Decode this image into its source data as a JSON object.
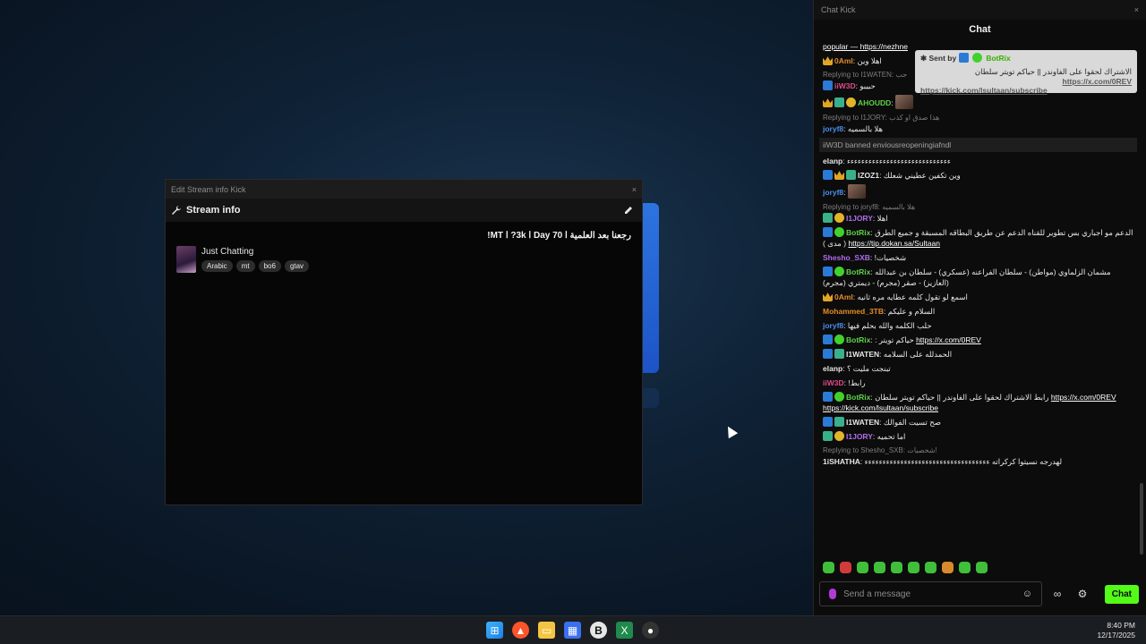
{
  "stream_window": {
    "titlebar": "Edit Stream info Kick",
    "close": "×",
    "header": "Stream info",
    "stream_title": "رجعنا بعد العلمية ا  Day 70  ا  3k?  ا  MT!",
    "category": "Just Chatting",
    "tags": [
      "Arabic",
      "mt",
      "bo6",
      "gtav"
    ]
  },
  "chat_window": {
    "titlebar": "Chat Kick",
    "close": "×",
    "header": "Chat",
    "pinned_snippet": "popular — https://nezhne",
    "tooltip": {
      "sent_by": "Sent by",
      "bot_name": "BotRix",
      "text": "الاشتراك لحقوا على الفاوندر || حياكم تويتر سلطان",
      "link1": "https://x.com/0REV",
      "link2": "https://kick.com/lsultaan/subscribe"
    },
    "messages": [
      {
        "user": "0Aml",
        "color": "#e38b2a",
        "text": "اهلا وين",
        "badges": [
          "crown"
        ]
      },
      {
        "reply": "Replying to I1WATEN: حب"
      },
      {
        "user": "iiW3D",
        "color": "#e04a8a",
        "text": "حبيبو",
        "badges": [
          "mod"
        ]
      },
      {
        "user": "AHOUDD",
        "color": "#5ed14a",
        "text": "",
        "badges": [
          "crown",
          "sub",
          "coin"
        ],
        "image": true
      },
      {
        "reply": "Replying to I1JORY: هذا صدق او كذب"
      },
      {
        "user": "joryf8",
        "color": "#4a8cf0",
        "text": "هلا بالسميه",
        "badges": []
      },
      {
        "system": "iiW3D banned enviousreopeningiafndl"
      },
      {
        "user": "elanp",
        "color": "#e6e6e6",
        "text": "ءءءءءءءءءءءءءءءءءءءءءءءءءءءءء",
        "badges": []
      },
      {
        "user": "IZOZ1",
        "color": "#e6e6e6",
        "text": "وين تكفين عطيني شعلك",
        "badges": [
          "mod",
          "crown",
          "sub"
        ]
      },
      {
        "user": "joryf8",
        "color": "#4a8cf0",
        "text": "",
        "badges": [],
        "image": true
      },
      {
        "reply": "Replying to joryf8: هلا بالسميه"
      },
      {
        "user": "I1JORY",
        "color": "#b06cf0",
        "text": "اهلا",
        "badges": [
          "sub",
          "coin"
        ]
      },
      {
        "user": "BotRix",
        "color": "#5ed14a",
        "text": "الدعم مو اجباري بس تطوير للقناه الدعم عن طريق البطاقه المسبقة و جميع الطرق ( مدى )",
        "link": "https://tip.dokan.sa/Sultaan",
        "badges": [
          "mod",
          "ver"
        ]
      },
      {
        "user": "Shesho_SXB",
        "color": "#b06cf0",
        "text": "شخصيات!",
        "badges": []
      },
      {
        "user": "BotRix",
        "color": "#5ed14a",
        "text": "مشمان الزلماوي (مواطن) - سلطان الفراعنه (عسكري) - سلطان بن عبدالله (العازيز) - صقر (مجرم) - ديمتري (مجرم)",
        "badges": [
          "mod",
          "ver"
        ]
      },
      {
        "user": "0Aml",
        "color": "#e38b2a",
        "text": "اسمع لو تقول كلمه عطايه مره ثانيه",
        "badges": [
          "crown"
        ]
      },
      {
        "user": "Mohammed_3TB",
        "color": "#e38b2a",
        "text": "السلام و عليكم",
        "badges": []
      },
      {
        "user": "joryf8",
        "color": "#4a8cf0",
        "text": "حلب الكلمه والله بحلم فيها",
        "badges": []
      },
      {
        "user": "BotRix",
        "color": "#5ed14a",
        "text": "حياكم تويتر :",
        "link": "https://x.com/0REV",
        "badges": [
          "mod",
          "ver"
        ]
      },
      {
        "user": "I1WATEN",
        "color": "#e6e6e6",
        "text": "الحمدلله على السلامه",
        "badges": [
          "mod",
          "sub"
        ]
      },
      {
        "user": "elanp",
        "color": "#e6e6e6",
        "text": "تبنجت مليت ؟",
        "badges": []
      },
      {
        "user": "iiW3D",
        "color": "#e04a8a",
        "text": "رابط!",
        "badges": []
      },
      {
        "user": "BotRix",
        "color": "#5ed14a",
        "text": "رابط الاشتراك لحقوا على الفاوندر || حياكم تويتر سلطان",
        "link": "https://x.com/0REV",
        "link2": "https://kick.com/lsultaan/subscribe",
        "badges": [
          "mod",
          "ver"
        ]
      },
      {
        "user": "I1WATEN",
        "color": "#e6e6e6",
        "text": "صح تسيت الفوالك",
        "badges": [
          "mod",
          "sub"
        ]
      },
      {
        "user": "I1JORY",
        "color": "#b06cf0",
        "text": "اما تحميه",
        "badges": [
          "sub",
          "coin"
        ]
      },
      {
        "reply": "Replying to Shesho_SXB: شخصيات!"
      },
      {
        "user": "1iSHATHA",
        "color": "#e6e6e6",
        "text": "لهدرجه نسيتوا كركراته ءءءءءءءءءءءءءءءءءءءءءءءءءءءءءءءءءءء",
        "badges": []
      }
    ],
    "input_placeholder": "Send a message",
    "chat_button": "Chat"
  },
  "taskbar": {
    "time": "8:40 PM",
    "date": "12/17/2025",
    "apps": [
      "windows-start",
      "brave-browser",
      "file-explorer",
      "microsoft-store",
      "bold-app",
      "excel",
      "recorder"
    ]
  }
}
